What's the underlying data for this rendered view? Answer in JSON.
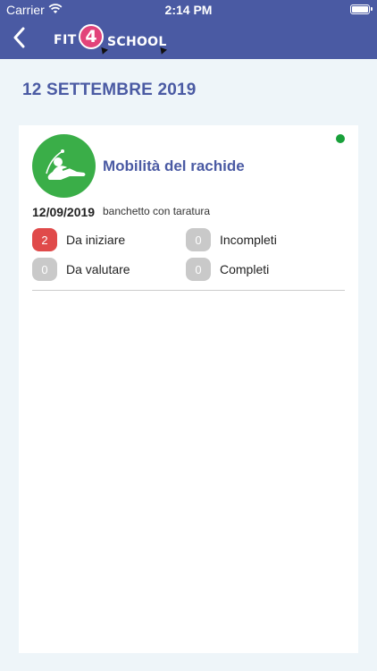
{
  "status_bar": {
    "carrier": "Carrier",
    "time": "2:14 PM"
  },
  "nav": {
    "logo_fit": "FIT",
    "logo_four": "4",
    "logo_school": "SCHOOL"
  },
  "page": {
    "title": "12 SETTEMBRE 2019"
  },
  "card": {
    "title": "Mobilità del rachide",
    "date": "12/09/2019",
    "equipment": "banchetto con taratura",
    "status_color": "#18a03a",
    "stats": [
      {
        "count": "2",
        "label": "Da iniziare"
      },
      {
        "count": "0",
        "label": "Incompleti"
      },
      {
        "count": "0",
        "label": "Da valutare"
      },
      {
        "count": "0",
        "label": "Completi"
      }
    ]
  },
  "colors": {
    "primary": "#4a5aa3",
    "accent_red": "#e04a4a",
    "icon_green": "#3aae48",
    "logo_pink": "#e2437a"
  }
}
